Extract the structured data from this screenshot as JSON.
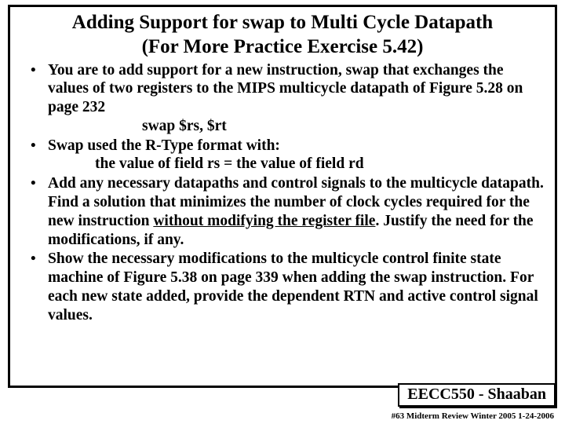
{
  "title_line1": "Adding Support for swap  to Multi Cycle Datapath",
  "title_line2": "(For More Practice Exercise 5.42)",
  "bullets": {
    "b1_part1": "You are to add support for a new instruction, swap that exchanges the values of two registers to the MIPS multicycle datapath of Figure 5.28 on page 232",
    "b1_indent": "swap $rs, $rt",
    "b2_part1": "Swap used the R-Type format with:",
    "b2_indent": "the value of field rs   =   the value of field rd",
    "b3_part1": "Add any necessary datapaths and control signals to the multicycle datapath.  Find a solution that minimizes the number of clock cycles required for the new instruction ",
    "b3_underline": "without modifying the register file",
    "b3_part2": ".   Justify the need for the modifications, if any.",
    "b4": "Show the necessary modifications to the multicycle control finite state machine of Figure 5.38 on page 339 when adding  the swap instruction.  For each new state added, provide the dependent RTN and active control signal values."
  },
  "footer": {
    "box": "EECC550 - Shaaban",
    "meta": "#63   Midterm Review  Winter 2005 1-24-2006"
  }
}
